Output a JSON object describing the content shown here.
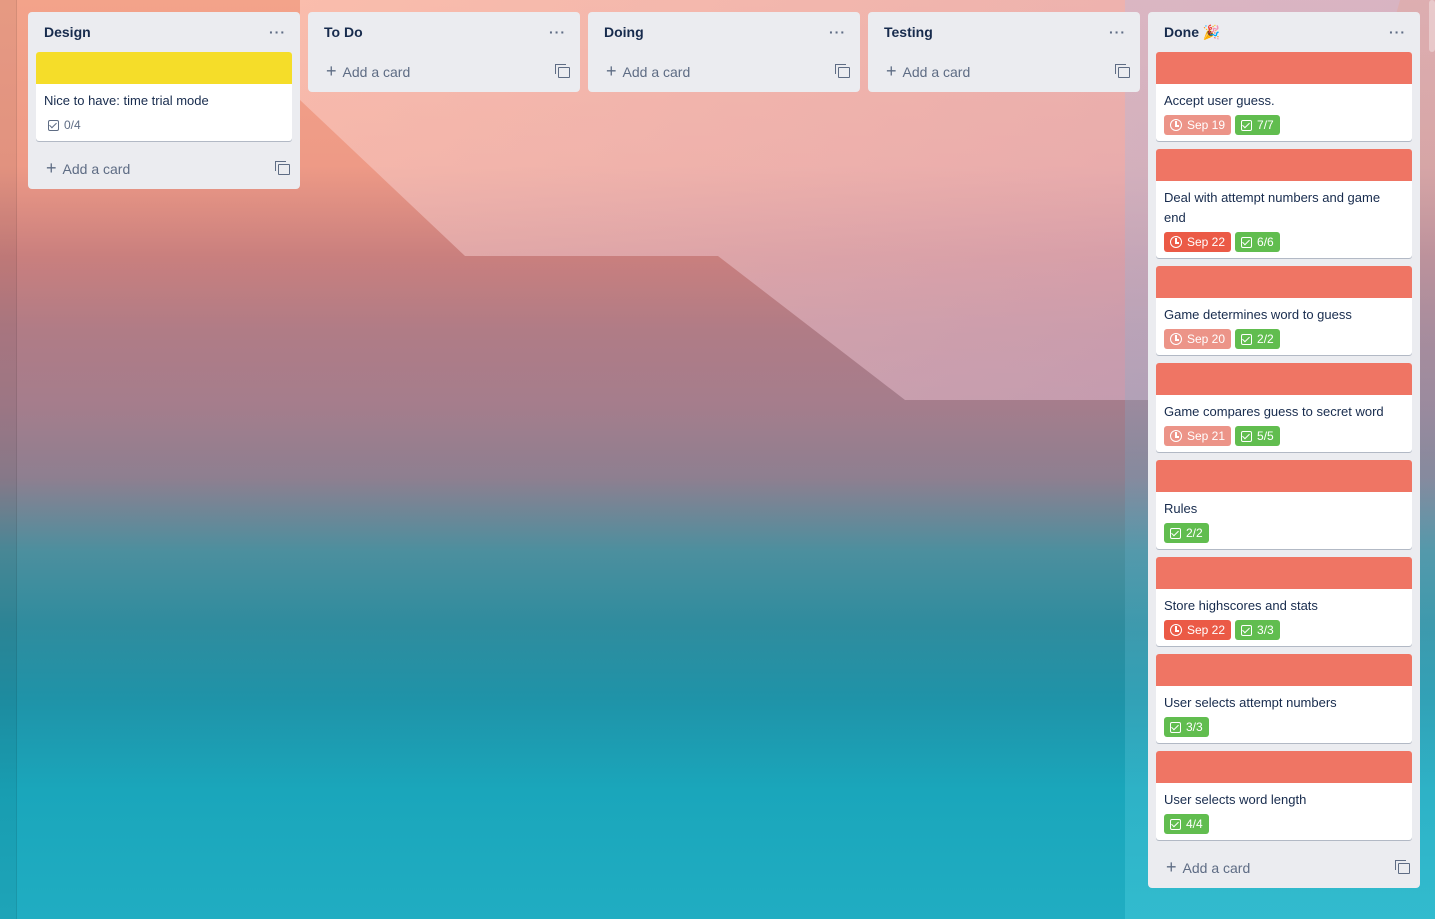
{
  "colors": {
    "list_bg": "#ebecf0",
    "label_yellow": "#f5dd29",
    "label_red": "#ef7564",
    "due_soft": "#ec9488",
    "due_late": "#eb5a46",
    "checklist_done": "#61bd4f"
  },
  "icons": {
    "list_menu": "more-horizontal-icon",
    "add": "plus-icon",
    "template": "card-template-icon",
    "due": "clock-icon",
    "checklist": "checkbox-icon"
  },
  "add_card_label": "Add a card",
  "menu_glyph": "···",
  "plus_glyph": "+",
  "lists": [
    {
      "title": "Design",
      "cards": [
        {
          "title": "Nice to have: time trial mode",
          "label": "yellow",
          "checklist": "0/4",
          "checklist_done": false
        }
      ]
    },
    {
      "title": "To Do",
      "cards": []
    },
    {
      "title": "Doing",
      "cards": []
    },
    {
      "title": "Testing",
      "cards": []
    },
    {
      "title": "Done 🎉",
      "cards": [
        {
          "title": "Accept user guess.",
          "label": "red",
          "due": "Sep 19",
          "due_state": "soft",
          "checklist": "7/7",
          "checklist_done": true
        },
        {
          "title": "Deal with attempt numbers and game end",
          "label": "red",
          "due": "Sep 22",
          "due_state": "late",
          "checklist": "6/6",
          "checklist_done": true
        },
        {
          "title": "Game determines word to guess",
          "label": "red",
          "due": "Sep 20",
          "due_state": "soft",
          "checklist": "2/2",
          "checklist_done": true
        },
        {
          "title": "Game compares guess to secret word",
          "label": "red",
          "due": "Sep 21",
          "due_state": "soft",
          "checklist": "5/5",
          "checklist_done": true
        },
        {
          "title": "Rules",
          "label": "red",
          "checklist": "2/2",
          "checklist_done": true
        },
        {
          "title": "Store highscores and stats",
          "label": "red",
          "due": "Sep 22",
          "due_state": "late",
          "checklist": "3/3",
          "checklist_done": true
        },
        {
          "title": "User selects attempt numbers",
          "label": "red",
          "checklist": "3/3",
          "checklist_done": true
        },
        {
          "title": "User selects word length",
          "label": "red",
          "checklist": "4/4",
          "checklist_done": true
        }
      ]
    }
  ]
}
